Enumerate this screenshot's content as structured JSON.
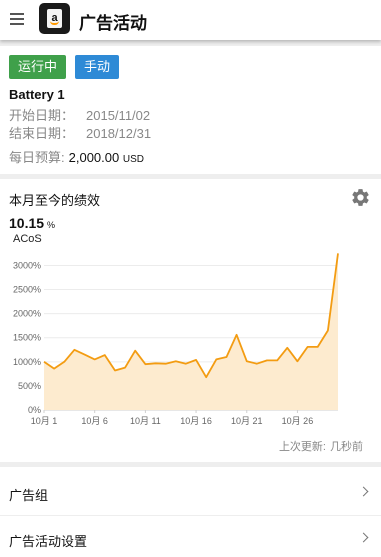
{
  "app_bar": {
    "title": "广告活动",
    "menu_icon": "menu-icon",
    "logo_icon": "amazon-tag-icon",
    "logo_letter": "a"
  },
  "status": {
    "running": "运行中",
    "mode": "手动",
    "running_color": "#3fa04a",
    "mode_color": "#2e8ad6"
  },
  "campaign": {
    "name": "Battery 1",
    "start_label": "开始日期：",
    "start_value": "2015/11/02",
    "end_label": "结束日期：",
    "end_value": "2018/12/31",
    "budget_label": "每日预算:",
    "budget_value": "2,000.00",
    "budget_currency": "USD"
  },
  "performance": {
    "title": "本月至今的绩效",
    "settings_icon": "gear-icon",
    "metric_value": "10.15",
    "metric_unit": "%",
    "metric_name": "ACoS",
    "updated_label": "上次更新:",
    "updated_value": "几秒前"
  },
  "chart_data": {
    "type": "area",
    "x": [
      "10月 1",
      "10月 2",
      "10月 3",
      "10月 4",
      "10月 5",
      "10月 6",
      "10月 7",
      "10月 8",
      "10月 9",
      "10月 10",
      "10月 11",
      "10月 12",
      "10月 13",
      "10月 14",
      "10月 15",
      "10月 16",
      "10月 17",
      "10月 18",
      "10月 19",
      "10月 20",
      "10月 21",
      "10月 22",
      "10月 23",
      "10月 24",
      "10月 25",
      "10月 26",
      "10月 27",
      "10月 28",
      "10月 29",
      "10月 30"
    ],
    "y": [
      1000,
      860,
      1000,
      1250,
      1150,
      1050,
      1140,
      820,
      880,
      1230,
      950,
      970,
      960,
      1010,
      960,
      1040,
      680,
      1050,
      1100,
      1560,
      1010,
      960,
      1030,
      1030,
      1290,
      1010,
      1310,
      1310,
      1650,
      3250
    ],
    "x_ticks": [
      "10月 1",
      "10月 6",
      "10月 11",
      "10月 16",
      "10月 21",
      "10月 26"
    ],
    "y_ticks": [
      "0%",
      "500%",
      "1000%",
      "1500%",
      "2000%",
      "2500%",
      "3000%"
    ],
    "ylim": [
      0,
      3300
    ],
    "y_unit": "%",
    "grid": true,
    "line_color": "#f39c12",
    "fill_color": "#fdebcf"
  },
  "list": {
    "ad_groups": "广告组",
    "campaign_settings": "广告活动设置",
    "chevron_icon": "chevron-right-icon"
  }
}
